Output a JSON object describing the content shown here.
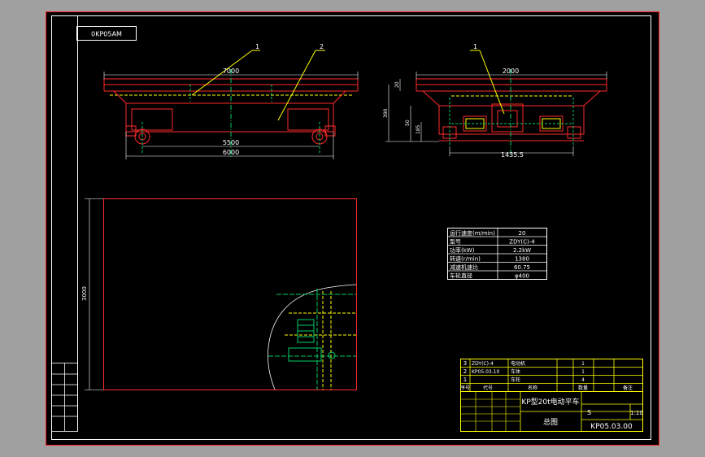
{
  "colors": {
    "background": "#a0a0a0",
    "sheet": "#000000",
    "frame": "#ff2020",
    "border": "#ffffff",
    "outline": "#ff2a2a",
    "centerline": "#00cc66",
    "hidden": "#ffff00",
    "leader": "#ffff00",
    "dimension": "#ffffff",
    "table_text": "#ffffff",
    "title_block": "#ffff00"
  },
  "drawing": {
    "code_box": "0KP05AM",
    "front_view": {
      "balloons": [
        "1",
        "2"
      ],
      "dim_top": "7000",
      "dim_inner": "5500",
      "dim_bottom": "6000"
    },
    "side_view": {
      "balloons": [
        "1"
      ],
      "dim_top": "2000",
      "dim_bottom": "1435.5",
      "dim_left": [
        "20",
        "390",
        "50",
        "185"
      ]
    },
    "detail_view": {
      "dim_left": "3000"
    }
  },
  "spec_table": {
    "rows": [
      {
        "label": "运行速度(m/min)",
        "value": "20"
      },
      {
        "label": "型号",
        "value": "ZDY(C)-4"
      },
      {
        "label": "功率(kW)",
        "value": "2.2kW"
      },
      {
        "label": "转速(r/min)",
        "value": "1380"
      },
      {
        "label": "减速机速比",
        "value": "60.75"
      },
      {
        "label": "车轮直径",
        "value": "φ400"
      }
    ]
  },
  "title_block": {
    "parts": [
      {
        "no": "3",
        "code": "ZDY(C)-4",
        "name": "电动机",
        "qty": "1"
      },
      {
        "no": "2",
        "code": "KP05.03.10",
        "name": "车体",
        "qty": "1"
      },
      {
        "no": "1",
        "code": "",
        "name": "车轮",
        "qty": "4"
      }
    ],
    "part_headers": [
      "序号",
      "代号",
      "名称",
      "数量",
      "备注"
    ],
    "title": "KP型20t电动平车",
    "view": "总图",
    "scale": "1:10",
    "drawing_no": "KP05.03.00",
    "sheet": "S"
  }
}
